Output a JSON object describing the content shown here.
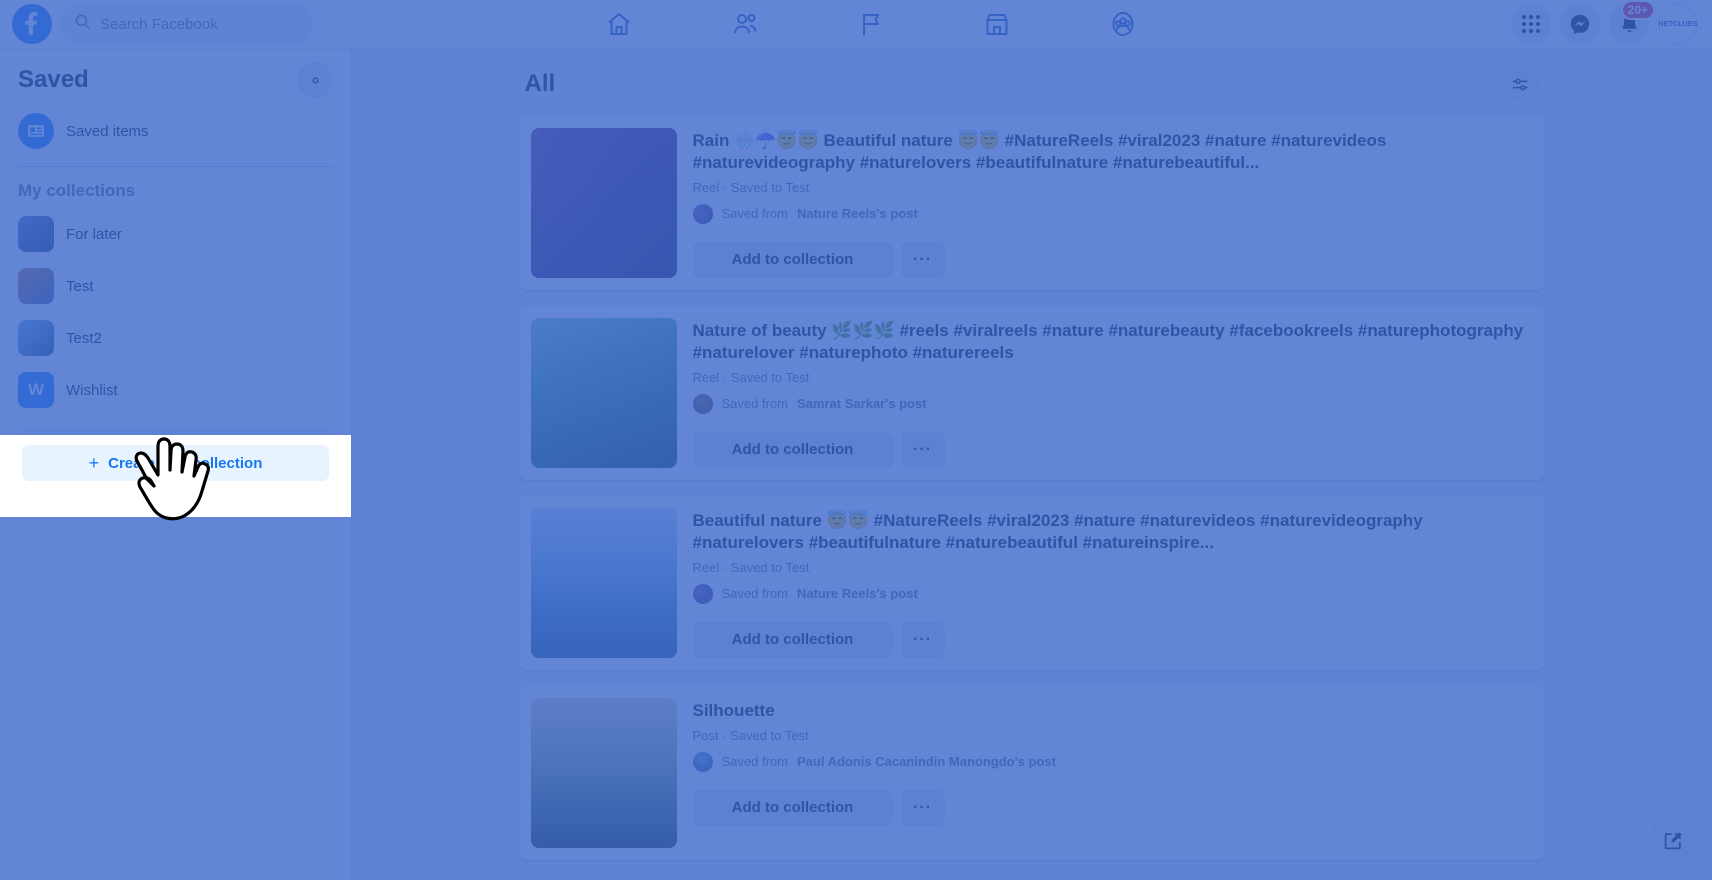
{
  "topbar": {
    "logo_icon": "facebook-logo-icon",
    "search": {
      "placeholder": "Search Facebook",
      "value": "",
      "icon": "search-icon"
    },
    "nav": [
      {
        "name": "home",
        "icon": "home-icon"
      },
      {
        "name": "friends",
        "icon": "friends-icon"
      },
      {
        "name": "pages",
        "icon": "flag-icon"
      },
      {
        "name": "marketplace",
        "icon": "store-icon"
      },
      {
        "name": "groups",
        "icon": "groups-icon"
      }
    ],
    "menu_icon": "grid-menu-icon",
    "messenger_icon": "messenger-icon",
    "notifications_icon": "bell-icon",
    "notifications_badge": "20+",
    "account_label": "NETCLUES"
  },
  "sidebar": {
    "title": "Saved",
    "settings_icon": "gear-icon",
    "saved_items": {
      "label": "Saved items",
      "icon": "saved-items-icon"
    },
    "section_label": "My collections",
    "collections": [
      {
        "label": "For later",
        "thumb_class": "c1",
        "initial": ""
      },
      {
        "label": "Test",
        "thumb_class": "c2",
        "initial": ""
      },
      {
        "label": "Test2",
        "thumb_class": "c3",
        "initial": ""
      },
      {
        "label": "Wishlist",
        "thumb_class": "c4",
        "initial": "W"
      }
    ],
    "create_button": {
      "label": "Create new collection",
      "plus": "+"
    }
  },
  "main": {
    "title": "All",
    "filter_icon": "filter-sliders-icon",
    "compose_icon": "compose-edit-icon",
    "saved_from_prefix": "Saved from",
    "items": [
      {
        "title": "Rain 🌧️☂️😇😇 Beautiful nature 😇😇 #NatureReels #viral2023 #nature #naturevideos #naturevideography #naturelovers #beautifulnature #naturebeautiful...",
        "meta": "Reel · Saved to Test",
        "source": "Nature Reels's post",
        "avatar_class": "g1",
        "thumb_class": "t1",
        "action_label": "Add to collection",
        "more_label": "···"
      },
      {
        "title": "Nature of beauty 🌿🌿🌿 #reels #viralreels #nature #naturebeauty #facebookreels #naturephotography #naturelover #naturephoto #naturereels",
        "meta": "Reel · Saved to Test",
        "source": "Samrat Sarkar's post",
        "avatar_class": "g2",
        "thumb_class": "t2",
        "action_label": "Add to collection",
        "more_label": "···"
      },
      {
        "title": "Beautiful nature 😇😇 #NatureReels #viral2023 #nature #naturevideos #naturevideography #naturelovers #beautifulnature #naturebeautiful #natureinspire...",
        "meta": "Reel · Saved to Test",
        "source": "Nature Reels's post",
        "avatar_class": "g1",
        "thumb_class": "t3",
        "action_label": "Add to collection",
        "more_label": "···"
      },
      {
        "title": "Silhouette",
        "meta": "Post · Saved to Test",
        "source": "Paul Adonis Cacanindin Manongdo's post",
        "avatar_class": "g3",
        "thumb_class": "t4",
        "action_label": "Add to collection",
        "more_label": "···"
      }
    ]
  },
  "overlay": {
    "scrim_color": "#3b66cc",
    "highlight_target": "create-new-collection-button",
    "cursor_icon": "pointing-hand-cursor"
  }
}
